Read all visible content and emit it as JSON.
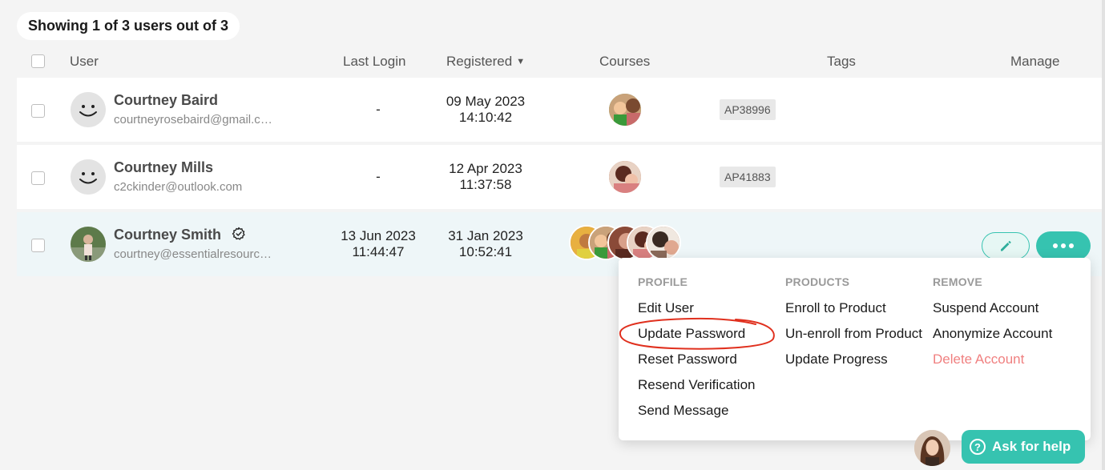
{
  "summary": {
    "text": "Showing 1 of 3 users out of 3"
  },
  "columns": {
    "user": "User",
    "last_login": "Last Login",
    "registered": "Registered",
    "registered_sort": "▼",
    "courses": "Courses",
    "tags": "Tags",
    "manage": "Manage"
  },
  "users": [
    {
      "name": "Courtney Baird",
      "email": "courtneyrosebaird@gmail.com",
      "last_login_date": "-",
      "last_login_time": "",
      "registered_date": "09 May 2023",
      "registered_time": "14:10:42",
      "tag": "AP38996",
      "avatar": "smiley-avatar"
    },
    {
      "name": "Courtney Mills",
      "email": "c2ckinder@outlook.com",
      "last_login_date": "-",
      "last_login_time": "",
      "registered_date": "12 Apr 2023",
      "registered_time": "11:37:58",
      "tag": "AP41883",
      "avatar": "smiley-avatar"
    },
    {
      "name": "Courtney Smith",
      "email": "courtney@essentialresources.com",
      "last_login_date": "13 Jun 2023",
      "last_login_time": "11:44:47",
      "registered_date": "31 Jan 2023",
      "registered_time": "10:52:41",
      "tag": "",
      "avatar": "photo-avatar",
      "badge_icon": "gear-badge-icon"
    }
  ],
  "menu": {
    "profile": {
      "heading": "PROFILE",
      "items": [
        "Edit User",
        "Update Password",
        "Reset Password",
        "Resend Verification",
        "Send Message"
      ]
    },
    "products": {
      "heading": "PRODUCTS",
      "items": [
        "Enroll to Product",
        "Un-enroll from Product",
        "Update Progress"
      ]
    },
    "remove": {
      "heading": "REMOVE",
      "items": [
        "Suspend Account",
        "Anonymize Account",
        "Delete Account"
      ]
    }
  },
  "help": {
    "label": "Ask for help",
    "icon": "question-circle-icon"
  },
  "colors": {
    "accent": "#36c3b0",
    "danger": "#f08080",
    "highlight_row": "#eef6f8",
    "annotation": "#e0301e"
  }
}
